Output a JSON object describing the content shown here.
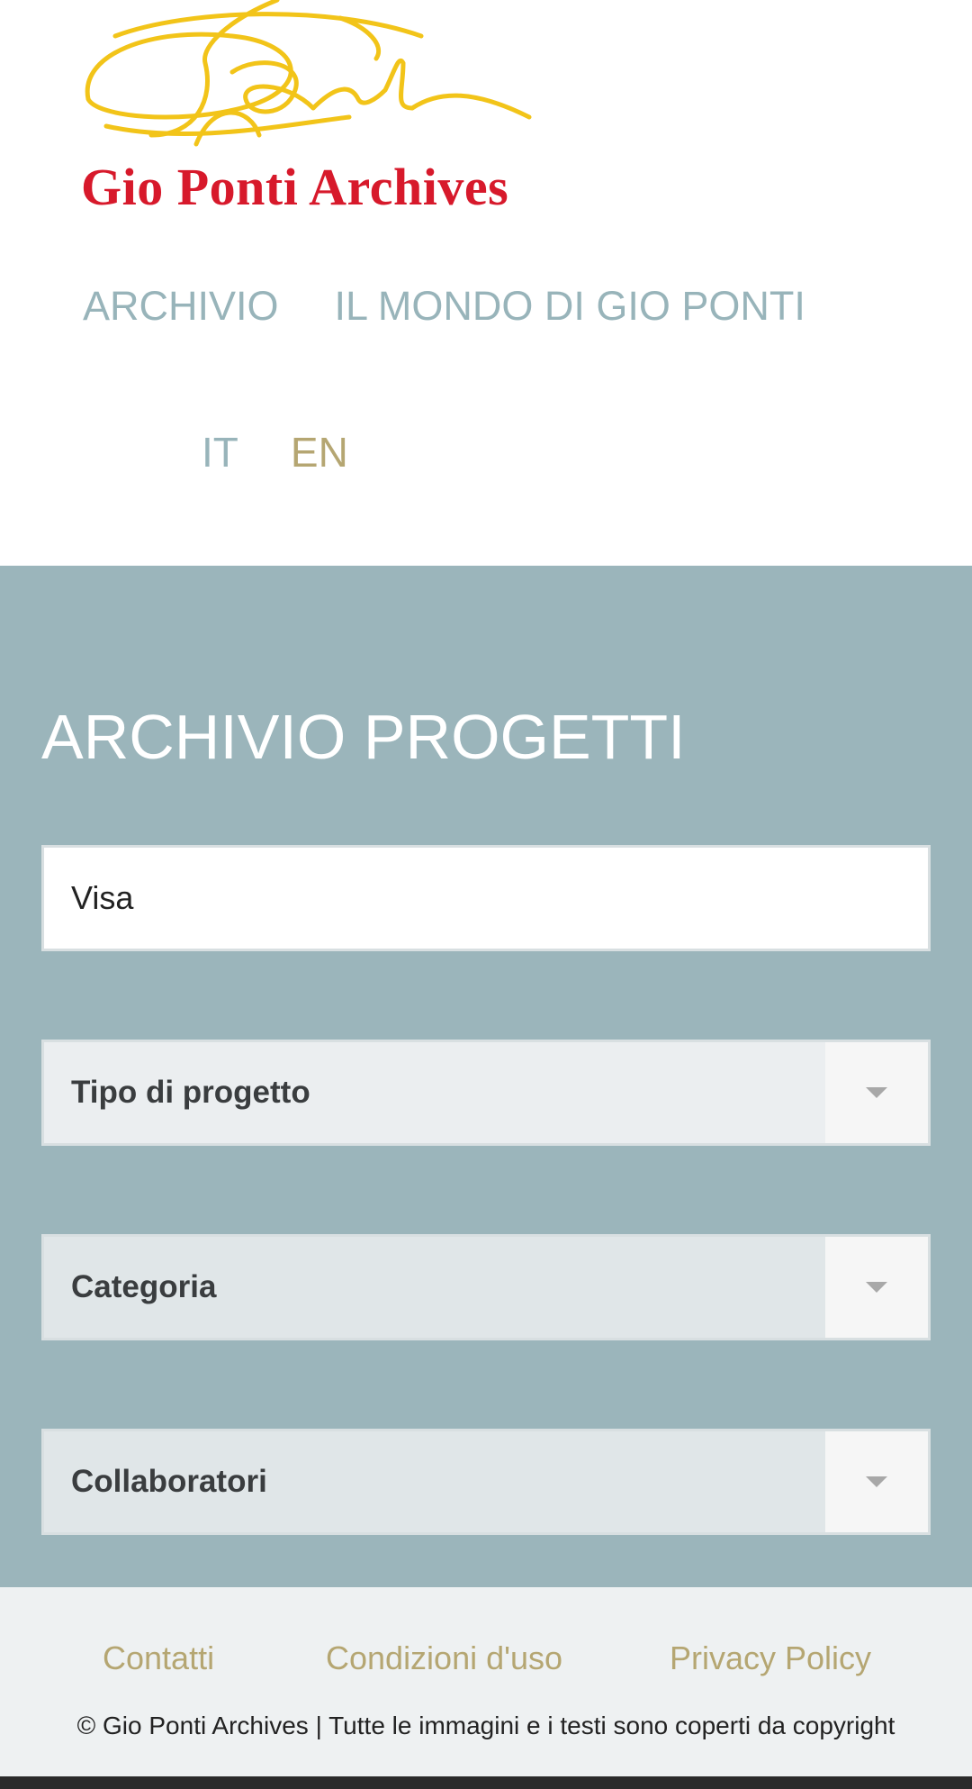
{
  "logo": {
    "text": "Gio Ponti Archives",
    "signature_color": "#f2c419",
    "text_color": "#d7192b"
  },
  "nav": {
    "items": [
      {
        "label": "ARCHIVIO"
      },
      {
        "label": "IL MONDO DI GIO PONTI"
      }
    ]
  },
  "language": {
    "it": "IT",
    "en": "EN",
    "active": "EN"
  },
  "main": {
    "title": "ARCHIVIO PROGETTI",
    "background": "#9bb5bb",
    "search": {
      "value": "Visa"
    },
    "filters": [
      {
        "label": "Tipo di progetto",
        "icon": "chevron-down-icon"
      },
      {
        "label": "Categoria",
        "icon": "chevron-down-icon"
      },
      {
        "label": "Collaboratori",
        "icon": "chevron-down-icon"
      }
    ]
  },
  "footer": {
    "links": [
      {
        "label": "Contatti"
      },
      {
        "label": "Condizioni d'uso"
      },
      {
        "label": "Privacy Policy"
      }
    ],
    "copyright": "© Gio Ponti Archives | Tutte le immagini e i testi sono coperti da copyright",
    "link_color": "#b5a672"
  }
}
